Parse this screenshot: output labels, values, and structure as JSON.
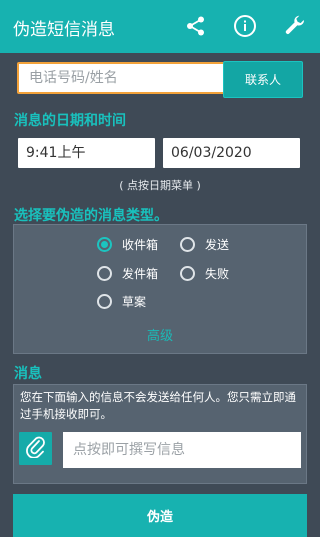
{
  "app": {
    "title": "伪造短信消息"
  },
  "toolbar": {
    "icons": [
      "share-icon",
      "info-icon",
      "wrench-icon"
    ]
  },
  "recipient": {
    "placeholder": "电话号码/姓名",
    "contacts_label": "联系人"
  },
  "datetime": {
    "section_title": "消息的日期和时间",
    "time_value": "9:41上午",
    "date_value": "06/03/2020",
    "hint": "( 点按日期菜单 )"
  },
  "message_type": {
    "section_title": "选择要伪造的消息类型。",
    "options": [
      {
        "label": "收件箱",
        "selected": true
      },
      {
        "label": "发送",
        "selected": false
      },
      {
        "label": "发件箱",
        "selected": false
      },
      {
        "label": "失败",
        "selected": false
      },
      {
        "label": "草案",
        "selected": false
      }
    ],
    "advanced_label": "高级"
  },
  "message": {
    "section_title": "消息",
    "note": "您在下面输入的信息不会发送给任何人。您只需立即通过手机接收即可。",
    "compose_placeholder": "点按即可撰写信息"
  },
  "actions": {
    "forge_label": "伪造"
  },
  "colors": {
    "accent": "#17b2b0",
    "background": "#3f4a56",
    "panel": "#566370",
    "focus_border": "#f2a23a"
  }
}
